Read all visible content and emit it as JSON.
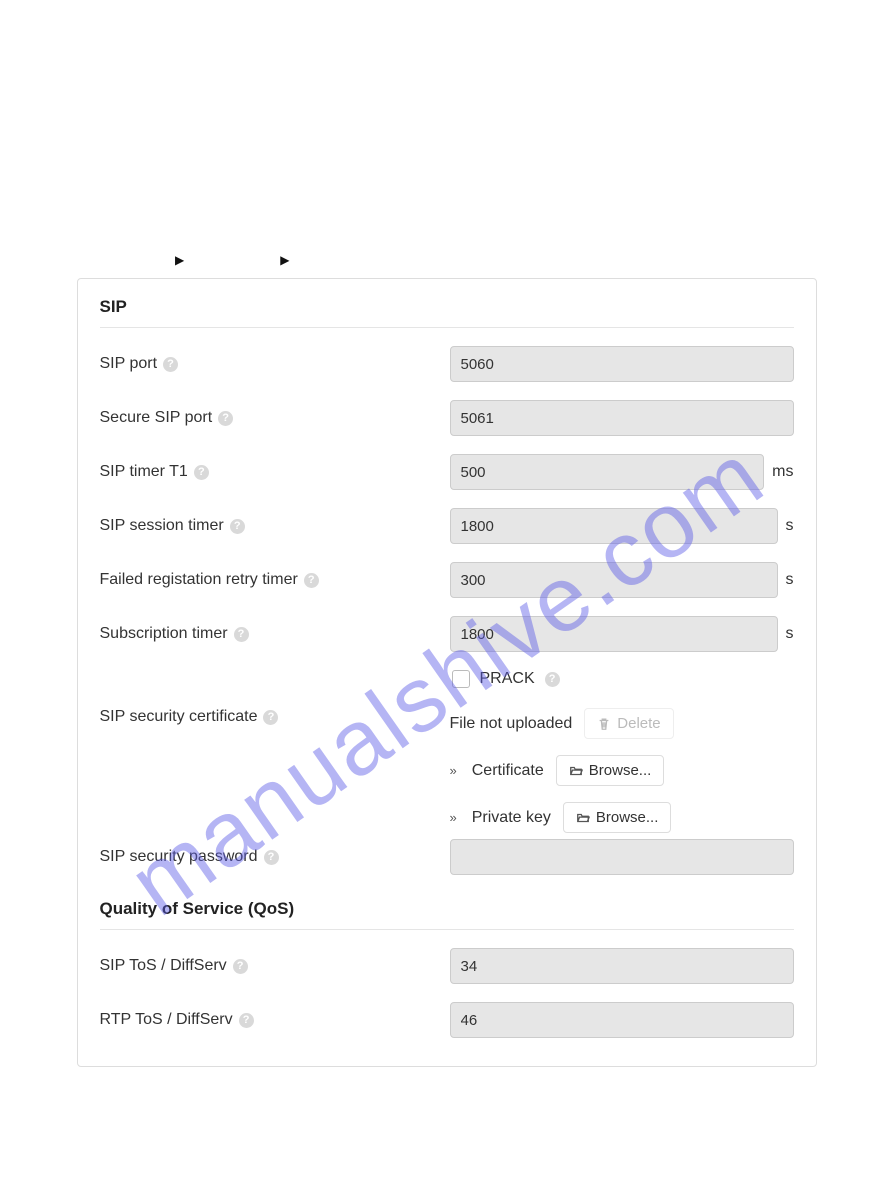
{
  "watermark": "manualshive.com",
  "sections": {
    "sip": {
      "title": "SIP"
    },
    "qos": {
      "title": "Quality of Service (QoS)"
    }
  },
  "fields": {
    "sip_port": {
      "label": "SIP port",
      "value": "5060",
      "unit": ""
    },
    "secure_sip_port": {
      "label": "Secure SIP port",
      "value": "5061",
      "unit": ""
    },
    "sip_timer_t1": {
      "label": "SIP timer T1",
      "value": "500",
      "unit": "ms"
    },
    "sip_session_timer": {
      "label": "SIP session timer",
      "value": "1800",
      "unit": "s"
    },
    "failed_reg_retry": {
      "label": "Failed registation retry timer",
      "value": "300",
      "unit": "s"
    },
    "subscription_timer": {
      "label": "Subscription timer",
      "value": "1800",
      "unit": "s"
    },
    "prack": {
      "label": "PRACK",
      "checked": false
    },
    "sip_sec_cert": {
      "label": "SIP security certificate"
    },
    "sip_sec_password": {
      "label": "SIP security password",
      "value": "",
      "unit": ""
    },
    "sip_tos": {
      "label": "SIP ToS / DiffServ",
      "value": "34",
      "unit": ""
    },
    "rtp_tos": {
      "label": "RTP ToS / DiffServ",
      "value": "46",
      "unit": ""
    }
  },
  "cert": {
    "file_status": "File not uploaded",
    "delete_label": "Delete",
    "certificate_label": "Certificate",
    "private_key_label": "Private key",
    "browse_label": "Browse..."
  }
}
